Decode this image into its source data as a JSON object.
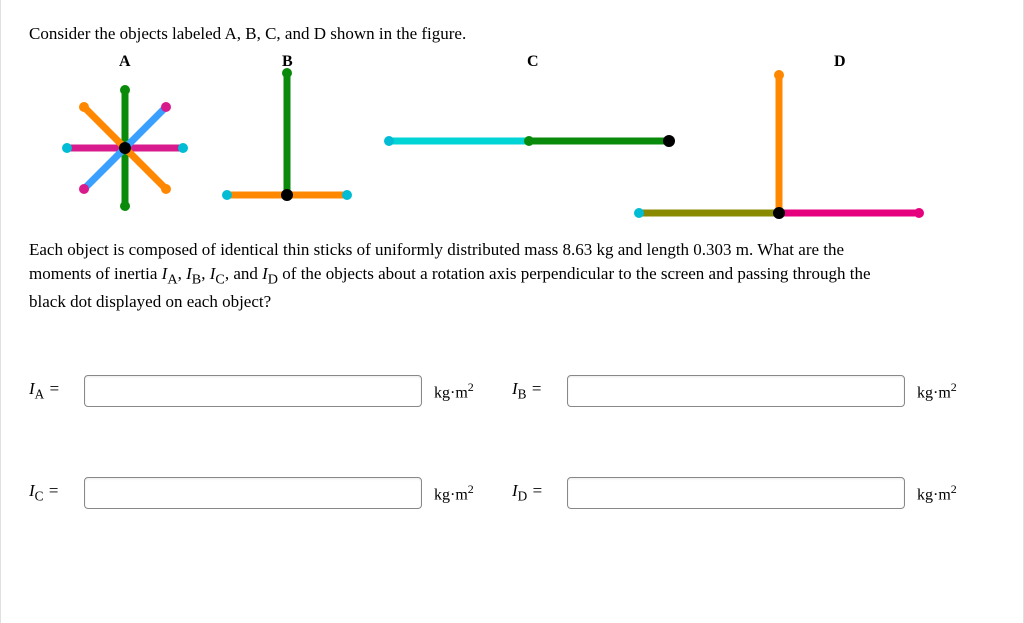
{
  "intro": "Consider the objects labeled A, B, C, and D shown in the figure.",
  "labels": {
    "A": "A",
    "B": "B",
    "C": "C",
    "D": "D"
  },
  "body1": "Each object is composed of identical thin sticks of uniformly distributed mass 8.63 kg and length 0.303 m. What are the",
  "body2_pre": "moments of inertia ",
  "body2_post": " of the objects about a rotation axis perpendicular to the screen and passing through the",
  "body3": "black dot displayed on each object?",
  "var_list": {
    "a": "A",
    "b": "B",
    "c": "C",
    "d": "D"
  },
  "eq": " = ",
  "unit_base": "kg·m",
  "unit_exp": "2",
  "comma": ", ",
  "and": ", and ",
  "physics": {
    "stick_mass_kg": 8.63,
    "stick_length_m": 0.303,
    "objects": {
      "A": {
        "sticks": 4,
        "pivot": "center-of-cross",
        "geometry": "4 sticks crossing at midpoints (8-spoke star)"
      },
      "B": {
        "sticks": 2,
        "pivot": "midpoint-of-base",
        "geometry": "inverted T: vertical stick standing on center of horizontal stick"
      },
      "C": {
        "sticks": 2,
        "pivot": "right-end",
        "geometry": "two sticks end-to-end collinear, pivot at far right"
      },
      "D": {
        "sticks": 3,
        "pivot": "midpoint-of-base",
        "geometry": "vertical stick on center of two horizontal sticks placed end-to-end"
      }
    }
  },
  "chart_data": {
    "type": "diagram",
    "title": "Four rigid-body stick configurations A–D with pivot points",
    "stick_mass_kg": 8.63,
    "stick_length_m": 0.303
  }
}
